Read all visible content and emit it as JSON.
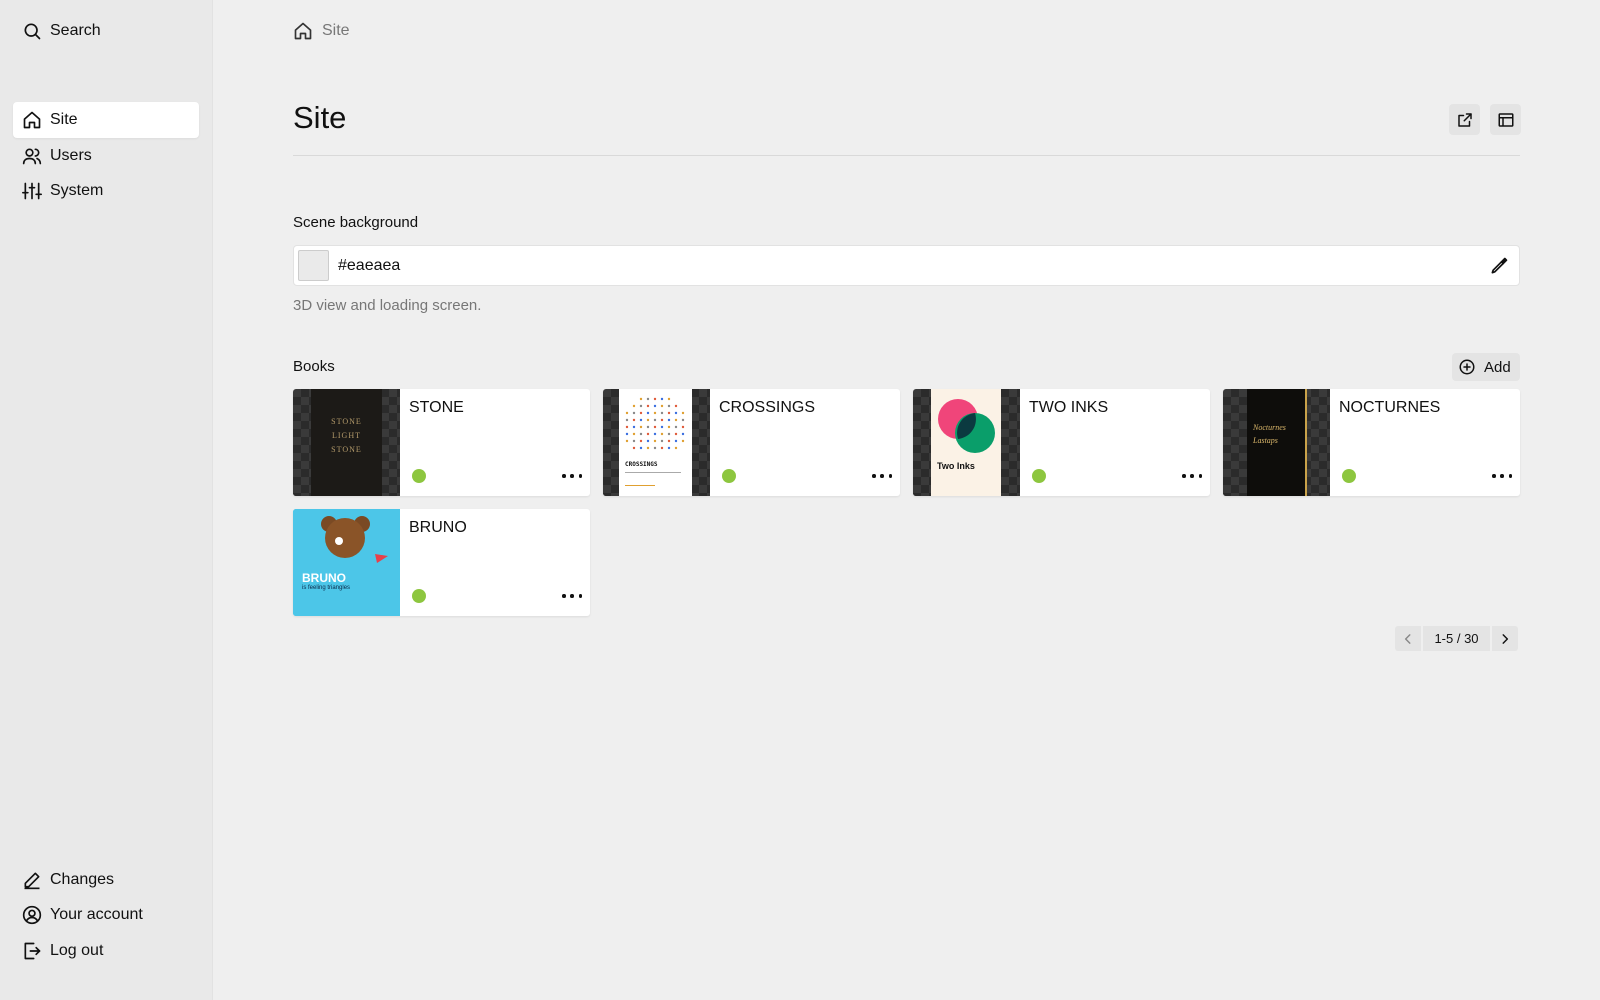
{
  "sidebar": {
    "search_label": "Search",
    "nav": [
      {
        "label": "Site",
        "icon": "home-icon",
        "active": true
      },
      {
        "label": "Users",
        "icon": "users-icon",
        "active": false
      },
      {
        "label": "System",
        "icon": "sliders-icon",
        "active": false
      }
    ],
    "footer": [
      {
        "label": "Changes",
        "icon": "pencil-icon"
      },
      {
        "label": "Your account",
        "icon": "user-circle-icon"
      },
      {
        "label": "Log out",
        "icon": "logout-icon"
      }
    ]
  },
  "breadcrumb": {
    "label": "Site",
    "icon": "home-icon"
  },
  "page": {
    "title": "Site",
    "actions": [
      "external-link-icon",
      "browser-window-icon"
    ]
  },
  "scene_background": {
    "label": "Scene background",
    "value": "#eaeaea",
    "swatch_color": "#eaeaea",
    "help": "3D view and loading screen."
  },
  "books": {
    "label": "Books",
    "add_label": "Add",
    "items": [
      {
        "title": "STONE",
        "status_color": "#8dc63f",
        "cover_text": [
          "STONE",
          "LIGHT",
          "STONE"
        ]
      },
      {
        "title": "CROSSINGS",
        "status_color": "#8dc63f",
        "cover_text": [
          "CROSSINGS"
        ]
      },
      {
        "title": "TWO INKS",
        "status_color": "#8dc63f",
        "cover_text": [
          "Two Inks"
        ]
      },
      {
        "title": "NOCTURNES",
        "status_color": "#8dc63f",
        "cover_text": [
          "Nocturnes",
          "Lastaps"
        ]
      },
      {
        "title": "BRUNO",
        "status_color": "#8dc63f",
        "cover_text": [
          "BRUNO",
          "is feeling triangles"
        ]
      }
    ]
  },
  "pagination": {
    "range": "1-5 / 30"
  }
}
